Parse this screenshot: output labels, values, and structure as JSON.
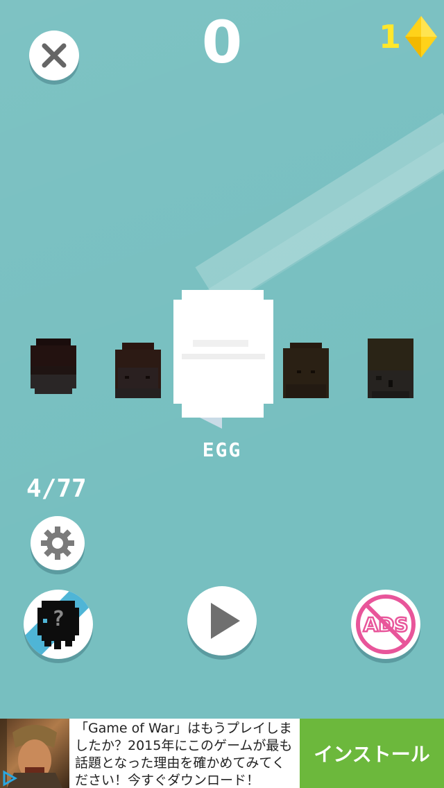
{
  "hud": {
    "score": "0",
    "gem_count": "1"
  },
  "carousel": {
    "selected_character": "EGG",
    "progress": "4/77"
  },
  "ad": {
    "text": "「Game of War」はもうプレイしましたか？2015年にこのゲームが最も話題となった理由を確かめてみてください！今すぐダウンロード！",
    "install_label": "インストール"
  },
  "colors": {
    "background": "#77bfc0",
    "gem": "#ffd21a",
    "gem_count": "#ffe72b",
    "no_ads": "#e8559a",
    "install": "#6cb83c"
  },
  "icons": [
    "close-icon",
    "diamond-icon",
    "gear-icon",
    "mystery-character-icon",
    "play-icon",
    "no-ads-icon",
    "ad-info-icon"
  ]
}
